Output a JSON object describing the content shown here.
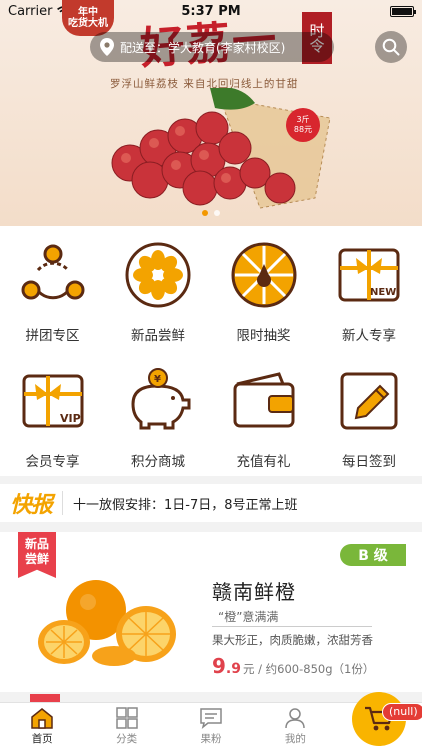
{
  "status_bar": {
    "carrier": "Carrier",
    "time": "5:37 PM"
  },
  "logo": {
    "line1": "年中",
    "line2": "吃货大机"
  },
  "location": {
    "label": "配送至：学大教育(李家村校区)"
  },
  "banner": {
    "headline": "好荔一",
    "seal": "时令",
    "subtitle": "罗浮山鲜荔枝 来自北回归线上的甘甜",
    "badge_line1": "3斤",
    "badge_line2": "88元",
    "slides": 2,
    "active_slide": 1
  },
  "grid": [
    {
      "label": "拼团专区",
      "icon": "group-buy-icon"
    },
    {
      "label": "新品尝鲜",
      "icon": "new-fruit-icon"
    },
    {
      "label": "限时抽奖",
      "icon": "lottery-wheel-icon"
    },
    {
      "label": "新人专享",
      "icon": "new-gift-icon"
    },
    {
      "label": "会员专享",
      "icon": "vip-gift-icon"
    },
    {
      "label": "积分商城",
      "icon": "piggy-bank-icon"
    },
    {
      "label": "充值有礼",
      "icon": "wallet-icon"
    },
    {
      "label": "每日签到",
      "icon": "sign-in-icon"
    }
  ],
  "news": {
    "tag": "快报",
    "text": "十一放假安排：1日-7日，8号正常上班"
  },
  "product": {
    "ribbon_line1": "新品",
    "ribbon_line2": "尝鲜",
    "grade": "B 级",
    "name": "赣南鲜橙",
    "slogan": "“橙”意满满",
    "desc": "果大形正，肉质脆嫩，浓甜芳香",
    "price_int": "9",
    "price_dec": ".9",
    "price_unit": "元 / 约600-850g（1份）"
  },
  "tabbar": [
    {
      "label": "首页",
      "icon": "home-icon",
      "active": true
    },
    {
      "label": "分类",
      "icon": "category-icon",
      "active": false
    },
    {
      "label": "果粉",
      "icon": "chat-icon",
      "active": false
    },
    {
      "label": "我的",
      "icon": "profile-icon",
      "active": false
    }
  ],
  "cart": {
    "badge": "(null)"
  },
  "colors": {
    "accent": "#f3a300",
    "brown": "#5b2a12",
    "red": "#e8404b",
    "green": "#7ab73a"
  }
}
